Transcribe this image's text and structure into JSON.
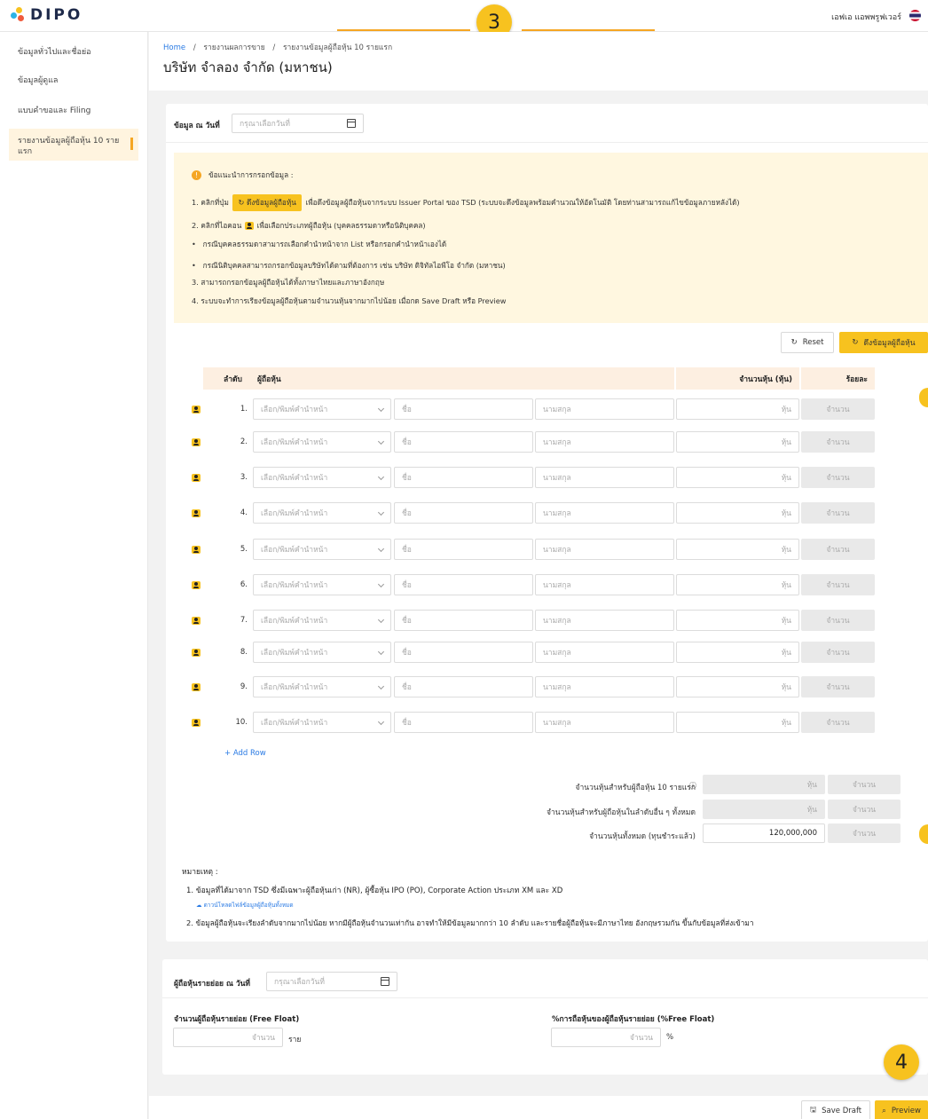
{
  "brand": {
    "logo_text": "DIPO"
  },
  "user": {
    "name": "เอฟเอ แอพพรูฟเวอร์"
  },
  "steps": {
    "badge_top": "3",
    "badge_bottom": "4"
  },
  "sidebar": {
    "items": [
      {
        "label": "ข้อมูลทั่วไปและชื่อย่อ"
      },
      {
        "label": "ข้อมูลผู้ดูแล"
      },
      {
        "label": "แบบคำขอและ Filing"
      },
      {
        "label": "รายงานข้อมูลผู้ถือหุ้น 10 ราย แรก"
      }
    ]
  },
  "breadcrumb": {
    "home": "Home",
    "sep": "/",
    "level1": "รายงานผลการขาย",
    "level2": "รายงานข้อมูลผู้ถือหุ้น 10 รายแรก"
  },
  "page": {
    "title": "บริษัท จำลอง จำกัด (มหาชน)"
  },
  "date_filter": {
    "label": "ข้อมูล ณ วันที่",
    "placeholder": "กรุณาเลือกวันที่"
  },
  "info": {
    "title": "ข้อแนะนำการกรอกข้อมูล :",
    "line1_pre": "1. คลิกที่ปุ่ม",
    "line1_btn": "ดึงข้อมูลผู้ถือหุ้น",
    "line1_post": "เพื่อดึงข้อมูลผู้ถือหุ้นจากระบบ Issuer Portal ของ TSD (ระบบจะดึงข้อมูลพร้อมคำนวณให้อัตโนมัติ โดยท่านสามารถแก้ไขข้อมูลภายหลังได้)",
    "line2_pre": "2. คลิกที่ไอคอน",
    "line2_post": "เพื่อเลือกประเภทผู้ถือหุ้น (บุคคลธรรมดาหรือนิติบุคคล)",
    "bullet1": "กรณีบุคคลธรรมดาสามารถเลือกคำนำหน้าจาก List หรือกรอกคำนำหน้าเองได้",
    "bullet2": "กรณีนิติบุคคลสามารถกรอกข้อมูลบริษัทได้ตามที่ต้องการ เช่น บริษัท ดิจิทัลไอพีโอ จำกัด (มหาชน)",
    "line3": "3. สามารถกรอกข้อมูลผู้ถือหุ้นได้ทั้งภาษาไทยและภาษาอังกฤษ",
    "line4": "4. ระบบจะทำการเรียงข้อมูลผู้ถือหุ้นตามจำนวนหุ้นจากมากไปน้อย เมื่อกด Save Draft หรือ Preview"
  },
  "actions": {
    "reset": "Reset",
    "fetch": "ดึงข้อมูลผู้ถือหุ้น",
    "add_row": "+ Add Row",
    "save_draft": "Save Draft",
    "preview": "Preview"
  },
  "table": {
    "headers": {
      "order": "ลำดับ",
      "holder": "ผู้ถือหุ้น",
      "shares": "จำนวนหุ้น (หุ้น)",
      "percent": "ร้อยละ"
    },
    "placeholders": {
      "prefix": "เลือก/พิมพ์คำนำหน้า",
      "first": "ชื่อ",
      "last": "นามสกุล",
      "unit": "หุ้น",
      "percent": "จำนวน"
    },
    "rows": [
      "1.",
      "2.",
      "3.",
      "4.",
      "5.",
      "6.",
      "7.",
      "8.",
      "9.",
      "10."
    ]
  },
  "summary": {
    "top10_label": "จำนวนหุ้นสำหรับผู้ถือหุ้น 10 รายแรก",
    "others_label": "จำนวนหุ้นสำหรับผู้ถือหุ้นในลำดับอื่น ๆ ทั้งหมด",
    "total_label": "จำนวนหุ้นทั้งหมด (ทุนชำระแล้ว)",
    "total_value": "120,000,000",
    "unit": "หุ้น",
    "percent_placeholder": "จำนวน"
  },
  "notes": {
    "title": "หมายเหตุ :",
    "n1": "1. ข้อมูลที่ได้มาจาก TSD ซึ่งมีเฉพาะผู้ถือหุ้นเก่า (NR), ผู้ซื้อหุ้น IPO (PO), Corporate Action ประเภท XM และ XD",
    "download": "ดาวน์โหลดไฟล์ข้อมูลผู้ถือหุ้นทั้งหมด",
    "n2": "2. ข้อมูลผู้ถือหุ้นจะเรียงลำดับจากมากไปน้อย หากมีผู้ถือหุ้นจำนวนเท่ากัน อาจทำให้มีข้อมูลมากกว่า 10 ลำดับ และรายชื่อผู้ถือหุ้นจะมีภาษาไทย อังกฤษรวมกัน ขึ้นกับข้อมูลที่ส่งเข้ามา"
  },
  "free_float": {
    "date_label": "ผู้ถือหุ้นรายย่อย ณ วันที่",
    "date_placeholder": "กรุณาเลือกวันที่",
    "count_label": "จำนวนผู้ถือหุ้นรายย่อย (Free Float)",
    "count_placeholder": "จำนวน",
    "count_unit": "ราย",
    "pct_label": "%การถือหุ้นของผู้ถือหุ้นรายย่อย (%Free Float)",
    "pct_placeholder": "จำนวน",
    "pct_unit": "%"
  },
  "colors": {
    "accent": "#f7c21f",
    "orange": "#f5a623",
    "link": "#2b7be4",
    "table_header": "#fdefe1",
    "info_bg": "#fff7e0"
  }
}
